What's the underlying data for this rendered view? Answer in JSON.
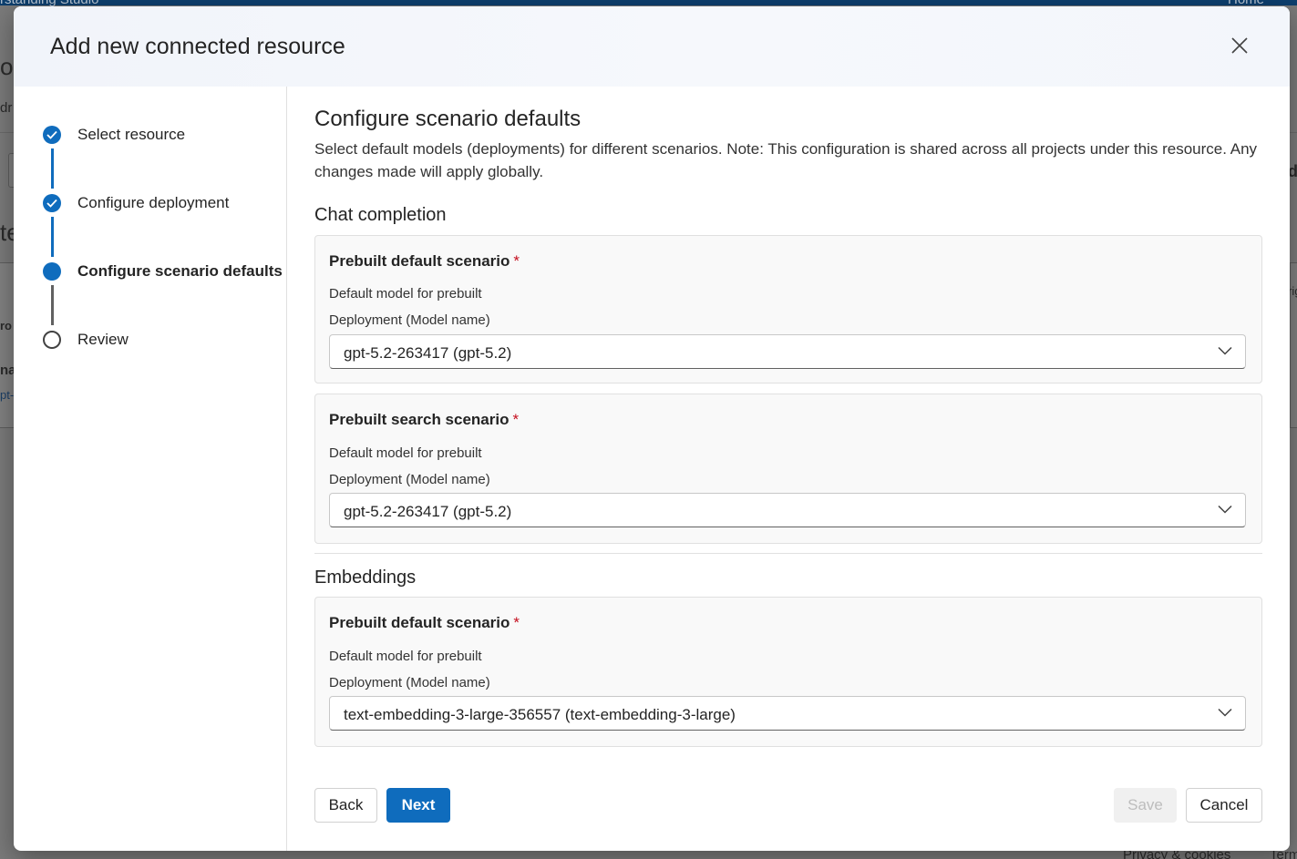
{
  "background": {
    "top_left_text": "rstanding Studio",
    "top_right_text": "Home",
    "left_frag_1": "o",
    "left_frag_2": "dr",
    "left_frag_3": "te",
    "left_frag_4": "ro",
    "left_frag_5": "na",
    "left_frag_6": "pt-",
    "right_frag_1": "de",
    "right_frag_2": "rig",
    "footer_link_1": "Privacy & cookies",
    "footer_link_2": "Term"
  },
  "dialog": {
    "title": "Add new connected resource",
    "close_label": "Close"
  },
  "stepper": {
    "steps": [
      {
        "label": "Select resource",
        "state": "done"
      },
      {
        "label": "Configure deployment",
        "state": "done"
      },
      {
        "label": "Configure scenario defaults",
        "state": "current"
      },
      {
        "label": "Review",
        "state": "todo"
      }
    ]
  },
  "main": {
    "title": "Configure scenario defaults",
    "description": "Select default models (deployments) for different scenarios. Note: This configuration is shared across all projects under this resource. Any changes made will apply globally.",
    "chat_group_title": "Chat completion",
    "embeddings_group_title": "Embeddings",
    "cards": [
      {
        "title": "Prebuilt default scenario",
        "required_mark": "*",
        "subtitle": "Default model for prebuilt",
        "field_label": "Deployment (Model name)",
        "selected_value": "gpt-5.2-263417 (gpt-5.2)"
      },
      {
        "title": "Prebuilt search scenario",
        "required_mark": "*",
        "subtitle": "Default model for prebuilt",
        "field_label": "Deployment (Model name)",
        "selected_value": "gpt-5.2-263417 (gpt-5.2)"
      },
      {
        "title": "Prebuilt default scenario",
        "required_mark": "*",
        "subtitle": "Default model for prebuilt",
        "field_label": "Deployment (Model name)",
        "selected_value": "text-embedding-3-large-356557 (text-embedding-3-large)"
      }
    ]
  },
  "footer": {
    "back_label": "Back",
    "next_label": "Next",
    "save_label": "Save",
    "cancel_label": "Cancel"
  },
  "colors": {
    "accent": "#0f6cbd",
    "required": "#c50f1f",
    "topbar": "#0d3f6e"
  }
}
